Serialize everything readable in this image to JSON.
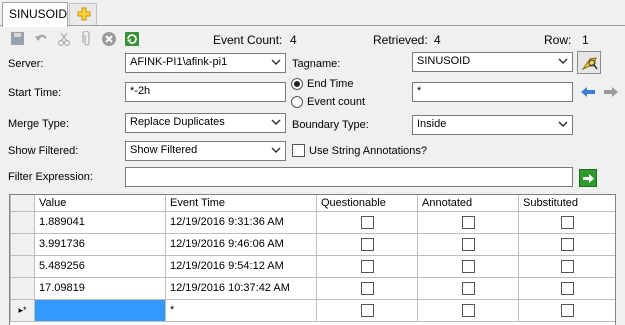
{
  "tab": {
    "label": "SINUSOID"
  },
  "status": {
    "event_count_label": "Event Count:",
    "event_count_value": "4",
    "retrieved_label": "Retrieved:",
    "retrieved_value": "4",
    "row_label": "Row:",
    "row_value": "1"
  },
  "form": {
    "server_label": "Server:",
    "server_value": "AFINK-PI1\\afink-pi1",
    "tagname_label": "Tagname:",
    "tagname_value": "SINUSOID",
    "start_time_label": "Start Time:",
    "start_time_value": "*-2h",
    "end_time_label": "End Time",
    "event_count_option_label": "Event count",
    "end_time_value": "*",
    "merge_type_label": "Merge Type:",
    "merge_type_value": "Replace Duplicates",
    "boundary_type_label": "Boundary Type:",
    "boundary_type_value": "Inside",
    "show_filtered_label": "Show Filtered:",
    "show_filtered_value": "Show Filtered",
    "string_annotations_label": "Use String Annotations?",
    "filter_expression_label": "Filter Expression:",
    "filter_expression_value": ""
  },
  "grid": {
    "columns": [
      "Value",
      "Event Time",
      "Questionable",
      "Annotated",
      "Substituted"
    ],
    "rows": [
      {
        "value": "1.889041",
        "time": "12/19/2016 9:31:36 AM"
      },
      {
        "value": "3.991736",
        "time": "12/19/2016 9:46:06 AM"
      },
      {
        "value": "5.489256",
        "time": "12/19/2016 9:54:12 AM"
      },
      {
        "value": "17.09819",
        "time": "12/19/2016 10:37:42 AM"
      }
    ],
    "new_row_marker": "▸*",
    "new_row_time": "*"
  },
  "colors": {
    "accent_blue": "#3399ff",
    "go_green": "#2e9a2e"
  }
}
